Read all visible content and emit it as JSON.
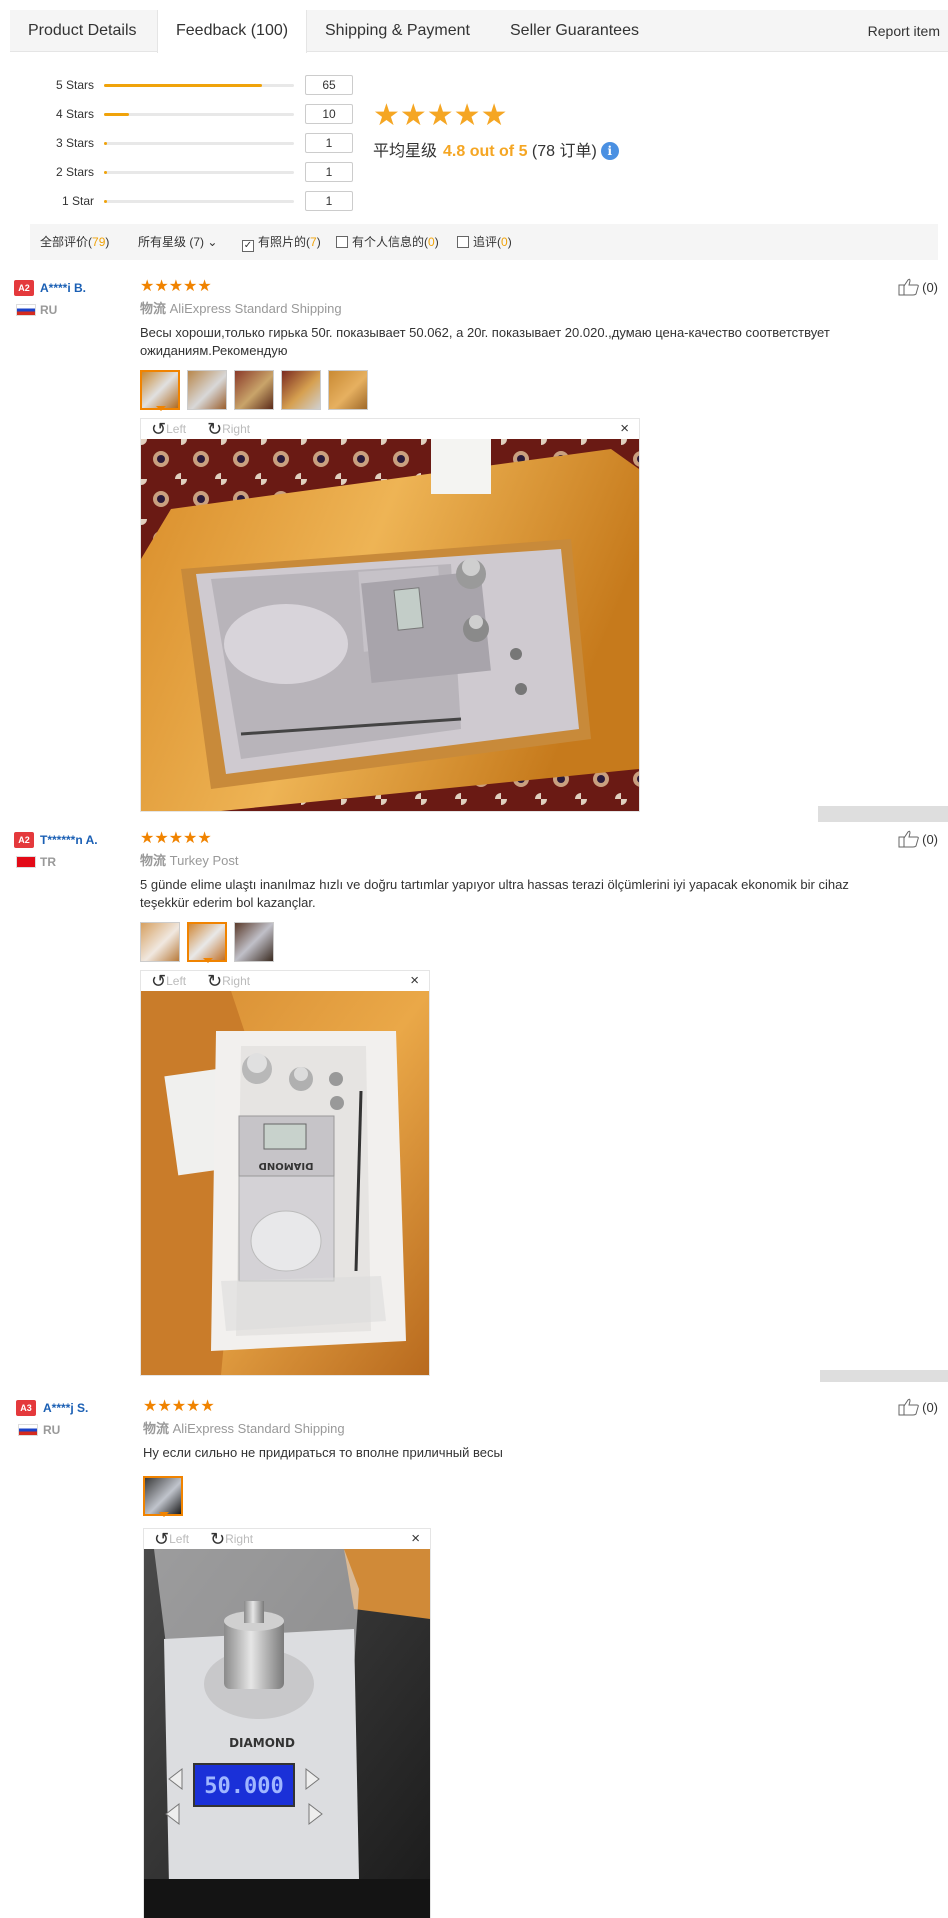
{
  "tabs": [
    {
      "label": "Product Details"
    },
    {
      "label": "Feedback (100)"
    },
    {
      "label": "Shipping & Payment"
    },
    {
      "label": "Seller Guarantees"
    }
  ],
  "report_label": "Report item",
  "rating_rows": [
    {
      "label": "5 Stars",
      "count": "65",
      "fraction": 0.83
    },
    {
      "label": "4 Stars",
      "count": "10",
      "fraction": 0.13
    },
    {
      "label": "3 Stars",
      "count": "1",
      "fraction": 0.015
    },
    {
      "label": "2 Stars",
      "count": "1",
      "fraction": 0.015
    },
    {
      "label": "1 Star",
      "count": "1",
      "fraction": 0.015
    }
  ],
  "summary": {
    "stars": "★★★★★",
    "avg_label": "平均星级",
    "avg_value": "4.8 out of 5",
    "orders": "(78 订单)",
    "info_icon": "i"
  },
  "filters": {
    "all_label": "全部评价",
    "all_count": "79",
    "stars_label": "所有星级 (7)",
    "photo_label": "有照片的",
    "photo_count": "7",
    "personal_label": "有个人信息的",
    "personal_count": "0",
    "followup_label": "追评",
    "followup_count": "0"
  },
  "viewer_labels": {
    "left": "Left",
    "right": "Right",
    "close": "×"
  },
  "reviews": [
    {
      "level": "A2",
      "name": "A****i B.",
      "country": "RU",
      "stars": "★★★★★",
      "logistics_label": "物流",
      "logistics": "AliExpress Standard Shipping",
      "text": "Весы хороши,только гирька 50г. показывает 50.062, а 20г. показывает 20.020.,думаю цена-качество соответствует ожиданиям.Рекомендую",
      "helpful": "(0)"
    },
    {
      "level": "A2",
      "name": "T******n A.",
      "country": "TR",
      "stars": "★★★★★",
      "logistics_label": "物流",
      "logistics": "Turkey Post",
      "text": "5 günde elime ulaştı inanılmaz hızlı ve doğru tartımlar yapıyor ultra hassas terazi ölçümlerini iyi yapacak ekonomik bir cihaz teşekkür ederim bol kazançlar.",
      "helpful": "(0)"
    },
    {
      "level": "A3",
      "name": "A****j S.",
      "country": "RU",
      "stars": "★★★★★",
      "logistics_label": "物流",
      "logistics": "AliExpress Standard Shipping",
      "text": "Ну если сильно не придираться то вполне приличный весы",
      "helpful": "(0)"
    }
  ],
  "scale_text": {
    "brand": "DIAMOND",
    "display_text": "50.000"
  },
  "colors": {
    "accent": "#f08300",
    "star": "#f5a623",
    "link": "#1a5fb4",
    "badge": "#e4393c",
    "bar_fill": "#f0a30a"
  },
  "icons": [
    "thumbs-up-icon",
    "rotate-left-icon",
    "rotate-right-icon",
    "close-icon",
    "info-icon",
    "checkbox-icon",
    "chevron-down-icon"
  ]
}
